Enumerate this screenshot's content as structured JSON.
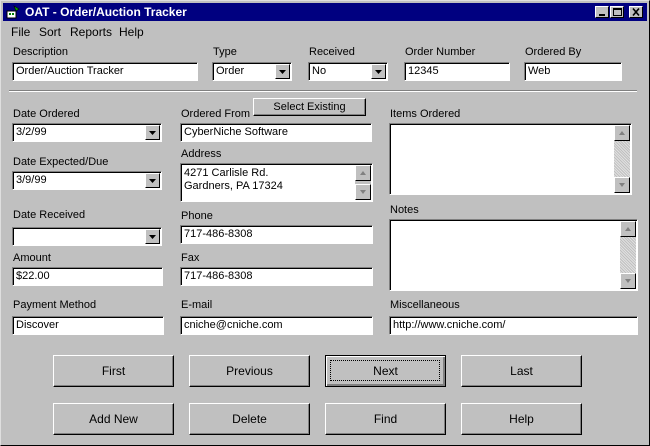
{
  "window": {
    "title": "OAT - Order/Auction Tracker"
  },
  "menu": {
    "file": "File",
    "sort": "Sort",
    "reports": "Reports",
    "help": "Help"
  },
  "top": {
    "description_label": "Description",
    "description_value": "Order/Auction Tracker",
    "type_label": "Type",
    "type_value": "Order",
    "received_label": "Received",
    "received_value": "No",
    "order_number_label": "Order Number",
    "order_number_value": "12345",
    "ordered_by_label": "Ordered By",
    "ordered_by_value": "Web"
  },
  "left": {
    "date_ordered_label": "Date Ordered",
    "date_ordered_value": "3/2/99",
    "date_expected_label": "Date Expected/Due",
    "date_expected_value": "3/9/99",
    "date_received_label": "Date Received",
    "date_received_value": "",
    "amount_label": "Amount",
    "amount_value": "$22.00",
    "payment_label": "Payment Method",
    "payment_value": "Discover"
  },
  "middle": {
    "ordered_from_label": "Ordered From",
    "select_existing_label": "Select Existing",
    "ordered_from_value": "CyberNiche Software",
    "address_label": "Address",
    "address_line1": "4271 Carlisle Rd.",
    "address_line2": "Gardners, PA 17324",
    "phone_label": "Phone",
    "phone_value": "717-486-8308",
    "fax_label": "Fax",
    "fax_value": "717-486-8308",
    "email_label": "E-mail",
    "email_value": "cniche@cniche.com"
  },
  "right": {
    "items_label": "Items Ordered",
    "items_value": "",
    "notes_label": "Notes",
    "notes_value": "",
    "misc_label": "Miscellaneous",
    "misc_value": "http://www.cniche.com/"
  },
  "buttons": {
    "first": "First",
    "previous": "Previous",
    "next": "Next",
    "last": "Last",
    "add_new": "Add New",
    "delete": "Delete",
    "find": "Find",
    "help": "Help"
  },
  "icons": {
    "app": "app-icon",
    "minimize": "minimize-icon",
    "maximize": "maximize-icon",
    "close": "close-icon",
    "dropdown": "chevron-down-icon",
    "scroll_up": "scroll-up-icon",
    "scroll_down": "scroll-down-icon"
  },
  "colors": {
    "titlebar": "#000080",
    "face": "#c0c0c0"
  }
}
